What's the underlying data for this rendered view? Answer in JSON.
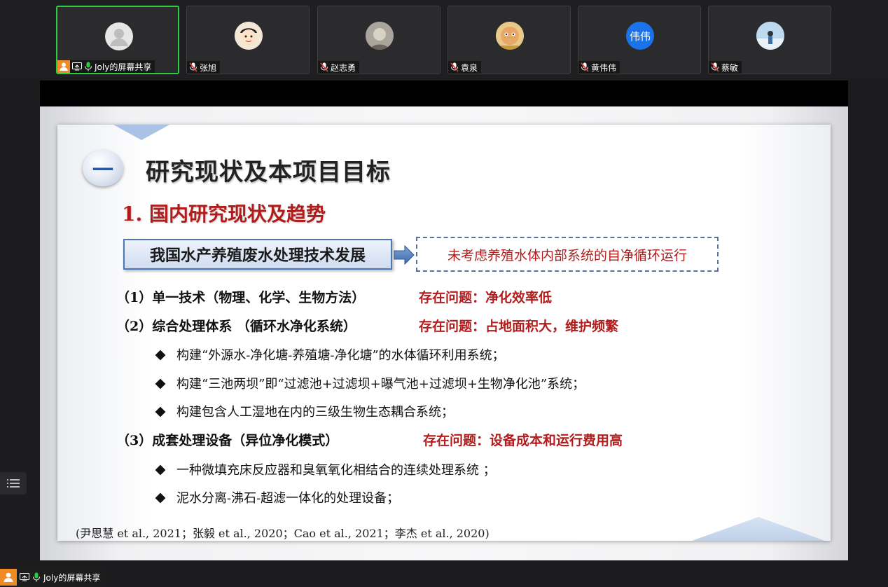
{
  "participants": [
    {
      "name": "Joly的屏幕共享",
      "avatar": "person-placeholder-icon",
      "active": true,
      "host": true,
      "sharing": true,
      "mic": "on"
    },
    {
      "name": "张旭",
      "avatar": "cartoon-avatar",
      "mic": "muted"
    },
    {
      "name": "赵志勇",
      "avatar": "photo-avatar",
      "mic": "muted"
    },
    {
      "name": "袁泉",
      "avatar": "cartoon-avatar",
      "mic": "muted"
    },
    {
      "name": "黄伟伟",
      "avatar_text": "伟伟",
      "avatar_color": "#1a73e8",
      "mic": "muted"
    },
    {
      "name": "蔡敏",
      "avatar": "photo-avatar",
      "mic": "muted"
    }
  ],
  "slide": {
    "section_number": "一",
    "title": "研究现状及本项目目标",
    "subtitle": "1. 国内研究现状及趋势",
    "tech_box": "我国水产养殖废水处理技术发展",
    "dashed_box": "未考虑养殖水体内部系统的自净循环运行",
    "items": [
      {
        "label": "（1）单一技术（物理、化学、生物方法）",
        "issue": "存在问题：净化效率低",
        "subitems": []
      },
      {
        "label": "（2）综合处理体系 （循环水净化系统）",
        "issue": "存在问题：占地面积大，维护频繁",
        "subitems": [
          "构建“外源水-净化塘-养殖塘-净化塘”的水体循环利用系统；",
          "构建“三池两坝”即“过滤池+过滤坝+曝气池+过滤坝+生物净化池”系统；",
          "构建包含人工湿地在内的三级生物生态耦合系统；"
        ]
      },
      {
        "label": "（3）成套处理设备（异位净化模式）",
        "issue": "存在问题：设备成本和运行费用高",
        "subitems": [
          "一种微填充床反应器和臭氧氧化相结合的连续处理系统 ；",
          "泥水分离-沸石-超滤一体化的处理设备；"
        ]
      }
    ],
    "citation": "(尹思慧 et al., 2021；张毅 et al., 2020；Cao et al., 2021；李杰 et al., 2020)"
  },
  "bottom": {
    "share_label": "Joly的屏幕共享"
  },
  "colors": {
    "accent_red": "#b11c1c",
    "active_border": "#2ecc40",
    "host_orange": "#f08a24"
  }
}
